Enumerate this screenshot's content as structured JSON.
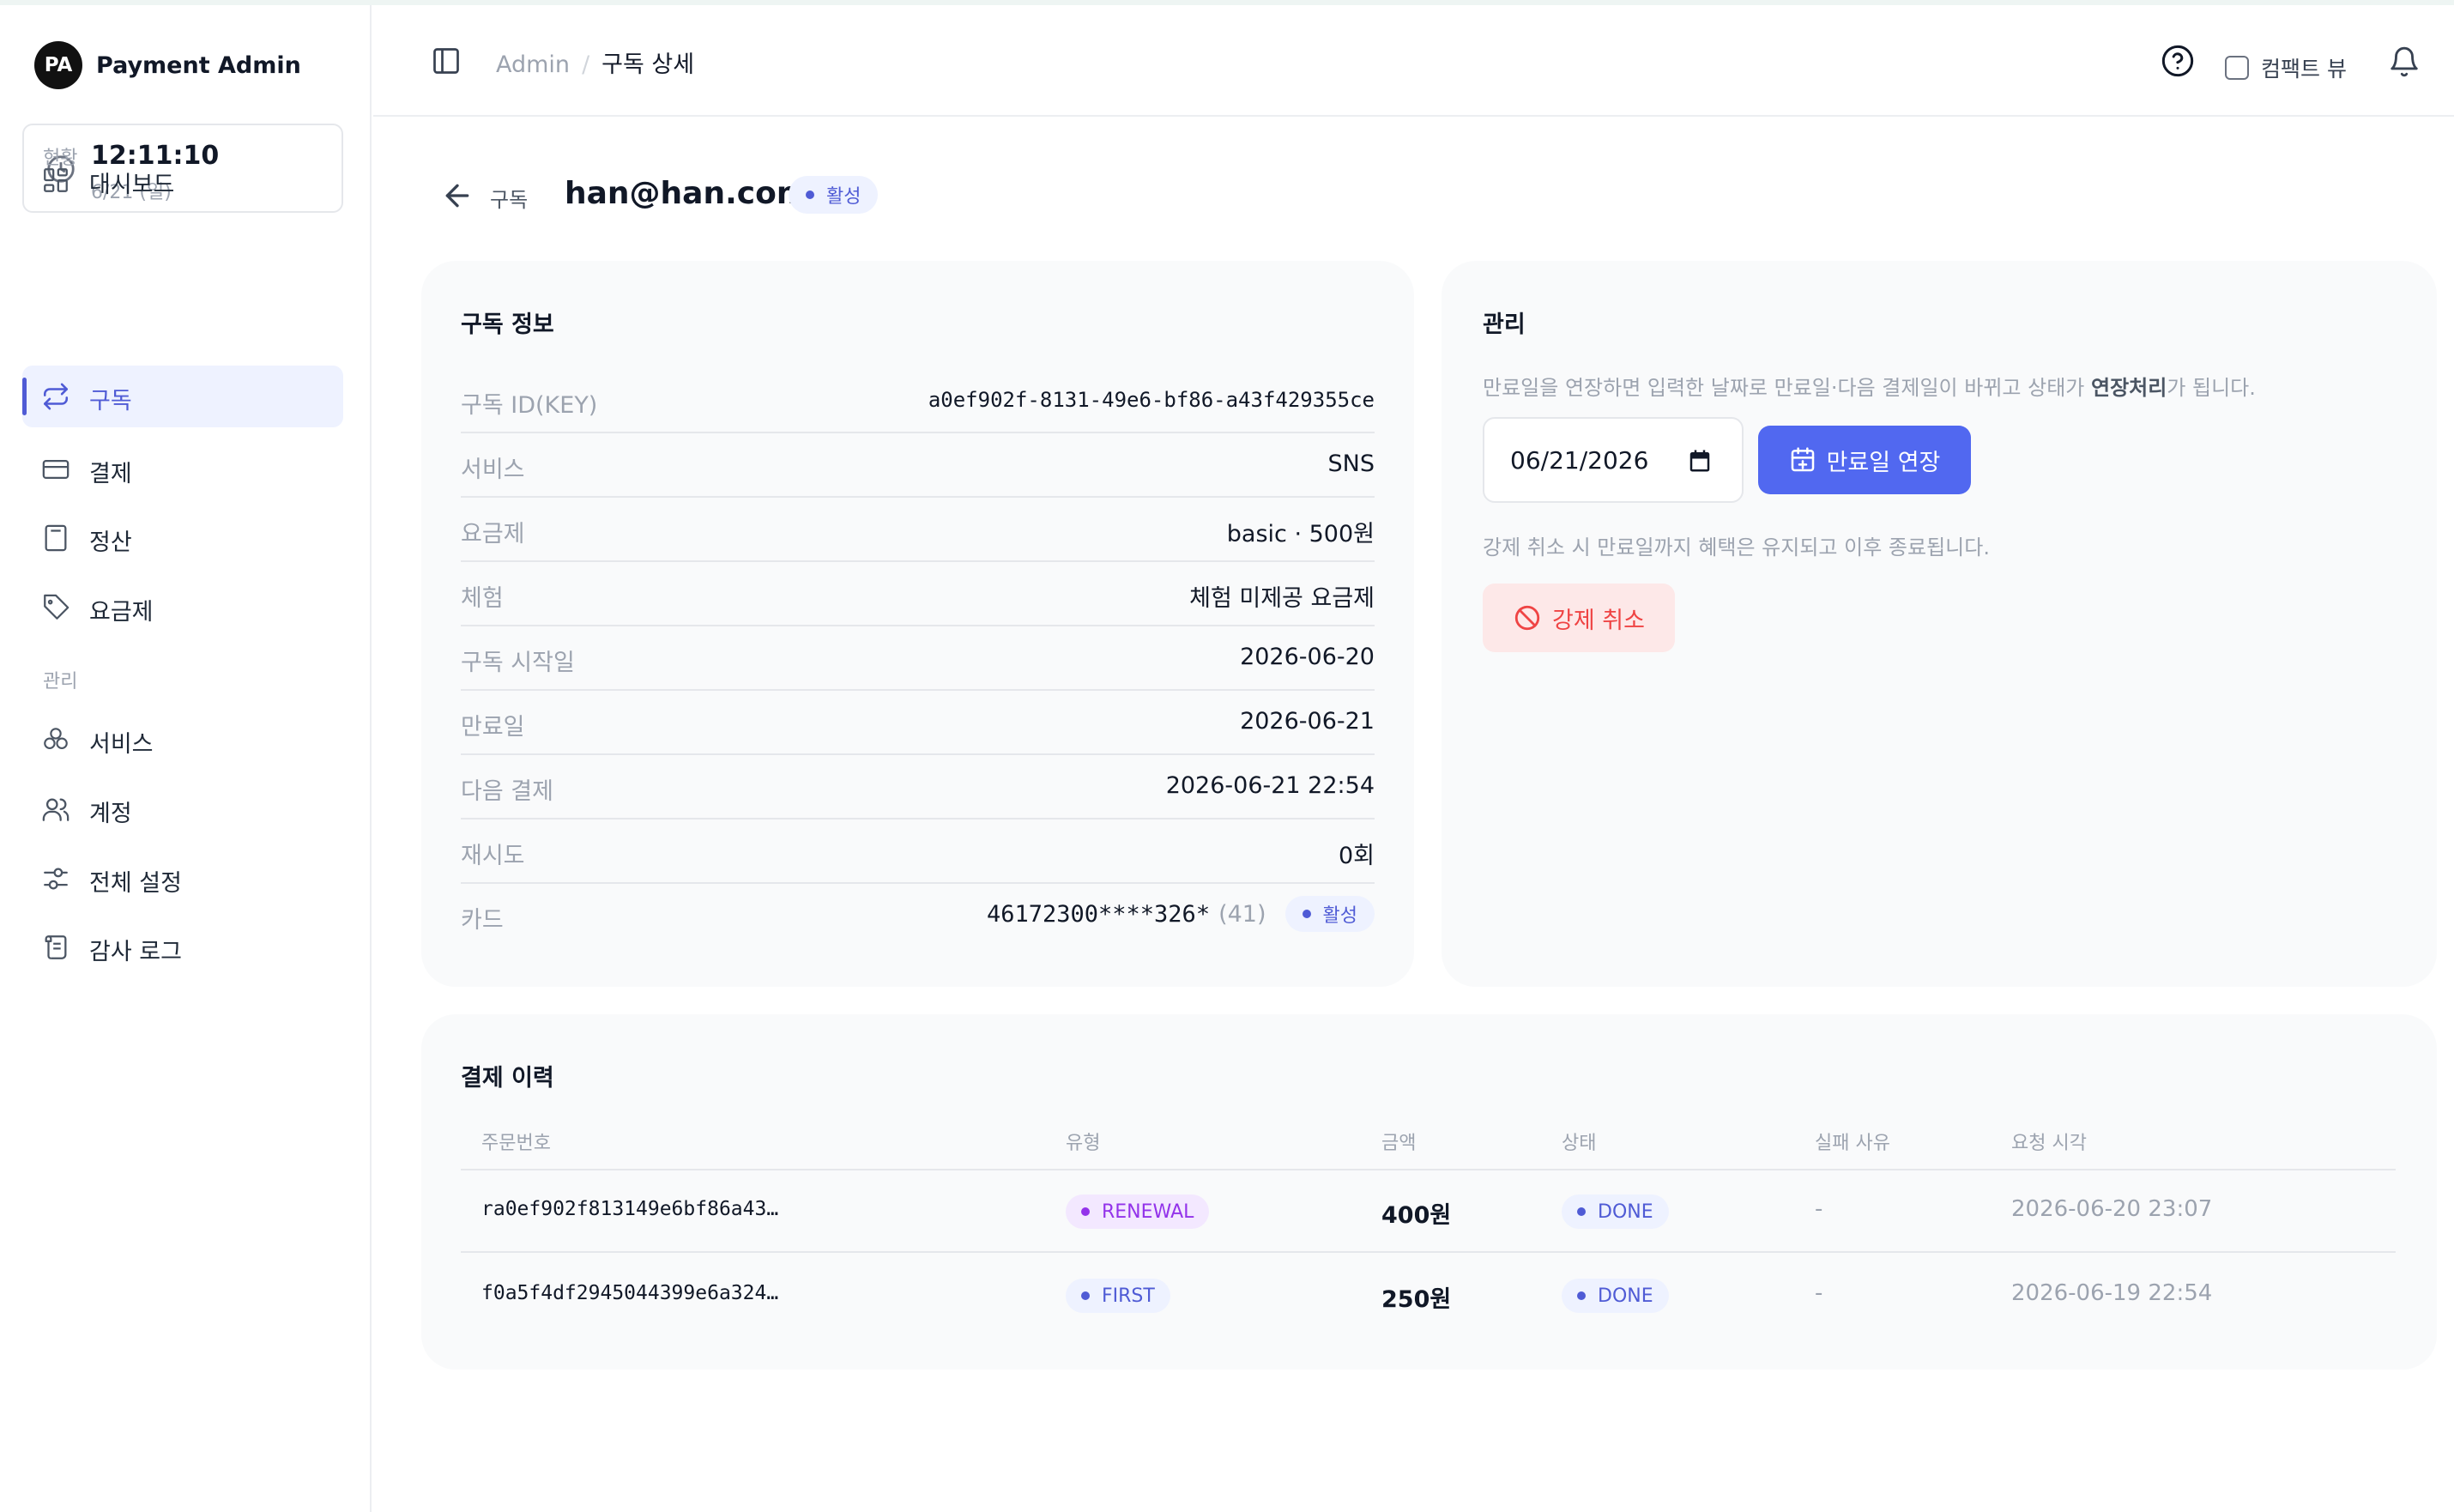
{
  "app": {
    "logo_initials": "PA",
    "name": "Payment Admin"
  },
  "clock": {
    "time": "12:11:10",
    "date": "6/21 (일)"
  },
  "sidebar": {
    "section_status": "현황",
    "section_manage": "관리",
    "items": [
      {
        "label": "대시보드",
        "icon": "dashboard-icon"
      },
      {
        "label": "구독",
        "icon": "repeat-icon",
        "active": true
      },
      {
        "label": "결제",
        "icon": "credit-card-icon"
      },
      {
        "label": "정산",
        "icon": "calculator-icon"
      },
      {
        "label": "요금제",
        "icon": "tag-icon"
      },
      {
        "label": "서비스",
        "icon": "boxes-icon"
      },
      {
        "label": "계정",
        "icon": "users-icon"
      },
      {
        "label": "전체 설정",
        "icon": "settings-sliders-icon"
      },
      {
        "label": "감사 로그",
        "icon": "scroll-icon"
      }
    ]
  },
  "header": {
    "breadcrumb_root": "Admin",
    "breadcrumb_separator": "/",
    "breadcrumb_current": "구독 상세",
    "compact_view_label": "컴팩트 뷰",
    "compact_view_checked": false
  },
  "page": {
    "back_label": "구독",
    "title": "han@han.com",
    "status_badge": "활성"
  },
  "info": {
    "title": "구독 정보",
    "rows": [
      {
        "key": "구독 ID(KEY)",
        "value": "a0ef902f-8131-49e6-bf86-a43f429355ce"
      },
      {
        "key": "서비스",
        "value": "SNS"
      },
      {
        "key": "요금제",
        "value": "basic · 500원"
      },
      {
        "key": "체험",
        "value": "체험 미제공 요금제"
      },
      {
        "key": "구독 시작일",
        "value": "2026-06-20"
      },
      {
        "key": "만료일",
        "value": "2026-06-21"
      },
      {
        "key": "다음 결제",
        "value": "2026-06-21 22:54"
      },
      {
        "key": "재시도",
        "value": "0회"
      }
    ],
    "card": {
      "key": "카드",
      "number": "46172300****326*",
      "count": "(41)",
      "badge": "활성"
    }
  },
  "manage": {
    "title": "관리",
    "extend_desc_before": "만료일을 연장하면 입력한 날짜로 만료일·다음 결제일이 바뀌고 상태가 ",
    "extend_desc_bold": "연장처리",
    "extend_desc_after": "가 됩니다.",
    "date_value": "06/21/2026",
    "extend_button": "만료일 연장",
    "cancel_desc": "강제 취소 시 만료일까지 혜택은 유지되고 이후 종료됩니다.",
    "cancel_button": "강제 취소"
  },
  "history": {
    "title": "결제 이력",
    "columns": [
      "주문번호",
      "유형",
      "금액",
      "상태",
      "실패 사유",
      "요청 시각"
    ],
    "rows": [
      {
        "order": "ra0ef902f813149e6bf86a43…",
        "type": "RENEWAL",
        "amount": "400원",
        "status": "DONE",
        "reason": "-",
        "requested_at": "2026-06-20 23:07"
      },
      {
        "order": "f0a5f4df2945044399e6a324…",
        "type": "FIRST",
        "amount": "250원",
        "status": "DONE",
        "reason": "-",
        "requested_at": "2026-06-19 22:54"
      }
    ]
  },
  "colors": {
    "accent": "#5168f0",
    "active_text": "#4f5bd5",
    "danger": "#ef4444",
    "renewal": "#9333ea"
  }
}
